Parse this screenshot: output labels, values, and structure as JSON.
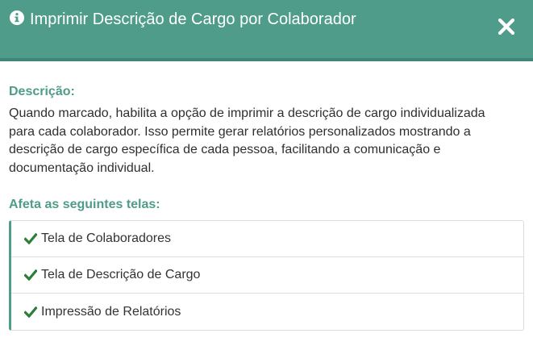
{
  "modal": {
    "title": "Imprimir Descrição de Cargo por Colaborador",
    "title_icon": "info-circle-icon",
    "close_icon": "close-icon"
  },
  "description": {
    "label": "Descrição:",
    "lines": [
      "Quando marcado, habilita a opção de imprimir a descrição de cargo individualizada",
      "para cada colaborador. Isso permite gerar relatórios personalizados mostrando a",
      "descrição de cargo específica de cada pessoa, facilitando a comunicação e",
      "documentação individual."
    ]
  },
  "affected": {
    "label": "Afeta as seguintes telas:",
    "item_icon": "check-icon",
    "items": [
      {
        "label": "Tela de Colaboradores"
      },
      {
        "label": "Tela de Descrição de Cargo"
      },
      {
        "label": "Impressão de Relatórios"
      }
    ]
  },
  "colors": {
    "header_bg": "#4e9c89",
    "accent": "#4e9c89",
    "check": "#2e7d3a"
  }
}
